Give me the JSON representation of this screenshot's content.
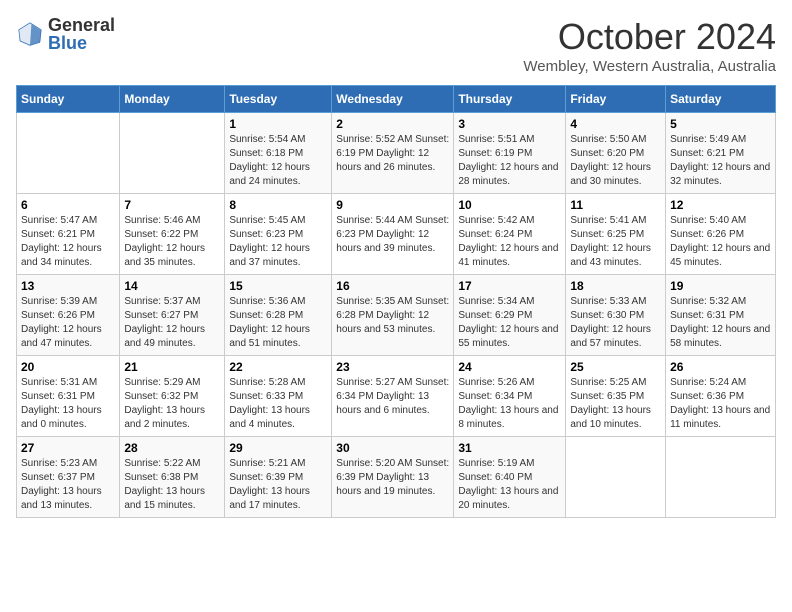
{
  "logo": {
    "general": "General",
    "blue": "Blue"
  },
  "header": {
    "month": "October 2024",
    "location": "Wembley, Western Australia, Australia"
  },
  "weekdays": [
    "Sunday",
    "Monday",
    "Tuesday",
    "Wednesday",
    "Thursday",
    "Friday",
    "Saturday"
  ],
  "weeks": [
    [
      {
        "day": "",
        "detail": ""
      },
      {
        "day": "",
        "detail": ""
      },
      {
        "day": "1",
        "detail": "Sunrise: 5:54 AM\nSunset: 6:18 PM\nDaylight: 12 hours and 24 minutes."
      },
      {
        "day": "2",
        "detail": "Sunrise: 5:52 AM\nSunset: 6:19 PM\nDaylight: 12 hours and 26 minutes."
      },
      {
        "day": "3",
        "detail": "Sunrise: 5:51 AM\nSunset: 6:19 PM\nDaylight: 12 hours and 28 minutes."
      },
      {
        "day": "4",
        "detail": "Sunrise: 5:50 AM\nSunset: 6:20 PM\nDaylight: 12 hours and 30 minutes."
      },
      {
        "day": "5",
        "detail": "Sunrise: 5:49 AM\nSunset: 6:21 PM\nDaylight: 12 hours and 32 minutes."
      }
    ],
    [
      {
        "day": "6",
        "detail": "Sunrise: 5:47 AM\nSunset: 6:21 PM\nDaylight: 12 hours and 34 minutes."
      },
      {
        "day": "7",
        "detail": "Sunrise: 5:46 AM\nSunset: 6:22 PM\nDaylight: 12 hours and 35 minutes."
      },
      {
        "day": "8",
        "detail": "Sunrise: 5:45 AM\nSunset: 6:23 PM\nDaylight: 12 hours and 37 minutes."
      },
      {
        "day": "9",
        "detail": "Sunrise: 5:44 AM\nSunset: 6:23 PM\nDaylight: 12 hours and 39 minutes."
      },
      {
        "day": "10",
        "detail": "Sunrise: 5:42 AM\nSunset: 6:24 PM\nDaylight: 12 hours and 41 minutes."
      },
      {
        "day": "11",
        "detail": "Sunrise: 5:41 AM\nSunset: 6:25 PM\nDaylight: 12 hours and 43 minutes."
      },
      {
        "day": "12",
        "detail": "Sunrise: 5:40 AM\nSunset: 6:26 PM\nDaylight: 12 hours and 45 minutes."
      }
    ],
    [
      {
        "day": "13",
        "detail": "Sunrise: 5:39 AM\nSunset: 6:26 PM\nDaylight: 12 hours and 47 minutes."
      },
      {
        "day": "14",
        "detail": "Sunrise: 5:37 AM\nSunset: 6:27 PM\nDaylight: 12 hours and 49 minutes."
      },
      {
        "day": "15",
        "detail": "Sunrise: 5:36 AM\nSunset: 6:28 PM\nDaylight: 12 hours and 51 minutes."
      },
      {
        "day": "16",
        "detail": "Sunrise: 5:35 AM\nSunset: 6:28 PM\nDaylight: 12 hours and 53 minutes."
      },
      {
        "day": "17",
        "detail": "Sunrise: 5:34 AM\nSunset: 6:29 PM\nDaylight: 12 hours and 55 minutes."
      },
      {
        "day": "18",
        "detail": "Sunrise: 5:33 AM\nSunset: 6:30 PM\nDaylight: 12 hours and 57 minutes."
      },
      {
        "day": "19",
        "detail": "Sunrise: 5:32 AM\nSunset: 6:31 PM\nDaylight: 12 hours and 58 minutes."
      }
    ],
    [
      {
        "day": "20",
        "detail": "Sunrise: 5:31 AM\nSunset: 6:31 PM\nDaylight: 13 hours and 0 minutes."
      },
      {
        "day": "21",
        "detail": "Sunrise: 5:29 AM\nSunset: 6:32 PM\nDaylight: 13 hours and 2 minutes."
      },
      {
        "day": "22",
        "detail": "Sunrise: 5:28 AM\nSunset: 6:33 PM\nDaylight: 13 hours and 4 minutes."
      },
      {
        "day": "23",
        "detail": "Sunrise: 5:27 AM\nSunset: 6:34 PM\nDaylight: 13 hours and 6 minutes."
      },
      {
        "day": "24",
        "detail": "Sunrise: 5:26 AM\nSunset: 6:34 PM\nDaylight: 13 hours and 8 minutes."
      },
      {
        "day": "25",
        "detail": "Sunrise: 5:25 AM\nSunset: 6:35 PM\nDaylight: 13 hours and 10 minutes."
      },
      {
        "day": "26",
        "detail": "Sunrise: 5:24 AM\nSunset: 6:36 PM\nDaylight: 13 hours and 11 minutes."
      }
    ],
    [
      {
        "day": "27",
        "detail": "Sunrise: 5:23 AM\nSunset: 6:37 PM\nDaylight: 13 hours and 13 minutes."
      },
      {
        "day": "28",
        "detail": "Sunrise: 5:22 AM\nSunset: 6:38 PM\nDaylight: 13 hours and 15 minutes."
      },
      {
        "day": "29",
        "detail": "Sunrise: 5:21 AM\nSunset: 6:39 PM\nDaylight: 13 hours and 17 minutes."
      },
      {
        "day": "30",
        "detail": "Sunrise: 5:20 AM\nSunset: 6:39 PM\nDaylight: 13 hours and 19 minutes."
      },
      {
        "day": "31",
        "detail": "Sunrise: 5:19 AM\nSunset: 6:40 PM\nDaylight: 13 hours and 20 minutes."
      },
      {
        "day": "",
        "detail": ""
      },
      {
        "day": "",
        "detail": ""
      }
    ]
  ]
}
